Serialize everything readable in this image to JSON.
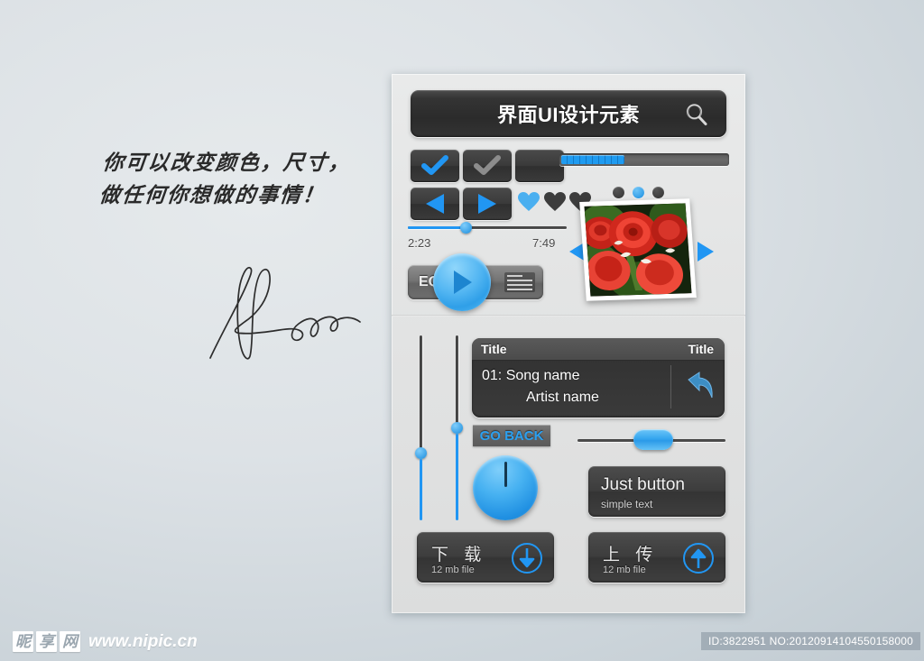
{
  "background": {
    "accent_blue": "#2196f3",
    "panel_bg": "#e3e4e4",
    "dark_ui": "#333333"
  },
  "annotation": {
    "handwriting": "你可以改变颜色，尺寸，\n做任何你想做的事情！",
    "signature_name": "Herben"
  },
  "panel": {
    "search": {
      "title": "界面UI设计元素",
      "placeholder": "界面UI设计元素",
      "icon": "search-icon"
    },
    "toggles": [
      {
        "name": "checkbox-checked-blue",
        "state": "checked",
        "color": "#2196f3"
      },
      {
        "name": "checkbox-checked-gray",
        "state": "checked",
        "color": "#8c8c8c"
      },
      {
        "name": "checkbox-empty",
        "state": "unchecked",
        "color": ""
      }
    ],
    "transport": [
      {
        "name": "previous-button",
        "icon": "triangle-left-icon"
      },
      {
        "name": "next-button",
        "icon": "triangle-right-icon"
      }
    ],
    "hearts": [
      {
        "name": "heart-filled-blue",
        "color": "#4aaff0"
      },
      {
        "name": "heart-filled-dark",
        "color": "#3c3c3c"
      },
      {
        "name": "heart-filled-dark-2",
        "color": "#3c3c3c"
      }
    ],
    "progress": {
      "value_percent": 38,
      "label": ""
    },
    "pager_dots": [
      {
        "name": "pager-dot-1",
        "active": false
      },
      {
        "name": "pager-dot-2",
        "active": true
      },
      {
        "name": "pager-dot-3",
        "active": false
      }
    ],
    "time_slider": {
      "position_percent": 38,
      "elapsed": "2:23",
      "total": "7:49"
    },
    "eq": {
      "label": "EQ",
      "playlist_icon": "playlist-icon",
      "play_icon": "play-icon"
    },
    "gallery": {
      "image_alt": "red-roses-photo",
      "prev_icon": "triangle-left-icon",
      "next_icon": "triangle-right-icon"
    }
  },
  "lower": {
    "vertical_sliders": [
      {
        "name": "vertical-slider-1",
        "value_percent": 38
      },
      {
        "name": "vertical-slider-2",
        "value_percent": 62
      }
    ],
    "song_box": {
      "header_left": "Title",
      "header_right": "Title",
      "track": "01: Song name",
      "artist": "Artist name",
      "back_icon": "reply-arrow-icon"
    },
    "go_back": {
      "label": "GO BACK"
    },
    "knob": {
      "name": "rotary-knob",
      "value_percent": 50
    },
    "pill_slider": {
      "value_percent": 51
    },
    "just_button": {
      "title": "Just button",
      "subtitle": "simple text"
    },
    "download": {
      "title": "下  载",
      "subtitle": "12 mb file",
      "icon": "arrow-down-circle-icon"
    },
    "upload": {
      "title": "上  传",
      "subtitle": "12 mb file",
      "icon": "arrow-up-circle-icon"
    }
  },
  "watermark": {
    "logo_chars": [
      "昵",
      "享",
      "网"
    ],
    "url": "www.nipic.cn",
    "id_line": "ID:3822951 NO:20120914104550158000"
  }
}
